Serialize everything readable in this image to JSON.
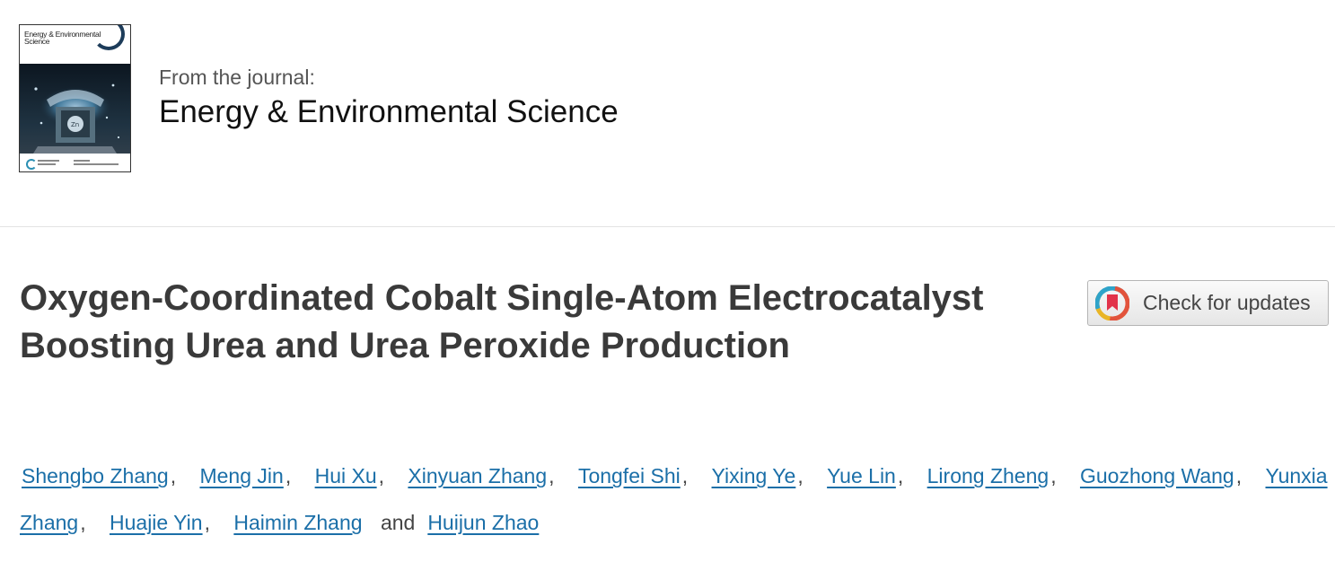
{
  "journal": {
    "cover_title": "Energy & Environmental Science",
    "from_label": "From the journal:",
    "name": "Energy & Environmental Science"
  },
  "article": {
    "title": "Oxygen-Coordinated Cobalt Single-Atom Electrocatalyst Boosting Urea and Urea Peroxide Production",
    "check_updates_label": "Check for updates",
    "check_updates_icon": "crossmark-icon",
    "authors": [
      "Shengbo Zhang",
      "Meng Jin",
      "Hui Xu",
      "Xinyuan Zhang",
      "Tongfei Shi",
      "Yixing Ye",
      "Yue Lin",
      "Lirong Zheng",
      "Guozhong Wang",
      "Yunxia Zhang",
      "Huajie Yin",
      "Haimin Zhang",
      "Huijun Zhao"
    ],
    "separator": ",",
    "conjunction": "and"
  },
  "colors": {
    "link": "#1b6fa8",
    "title": "#3a3a3a",
    "divider": "#e3e3e3"
  }
}
